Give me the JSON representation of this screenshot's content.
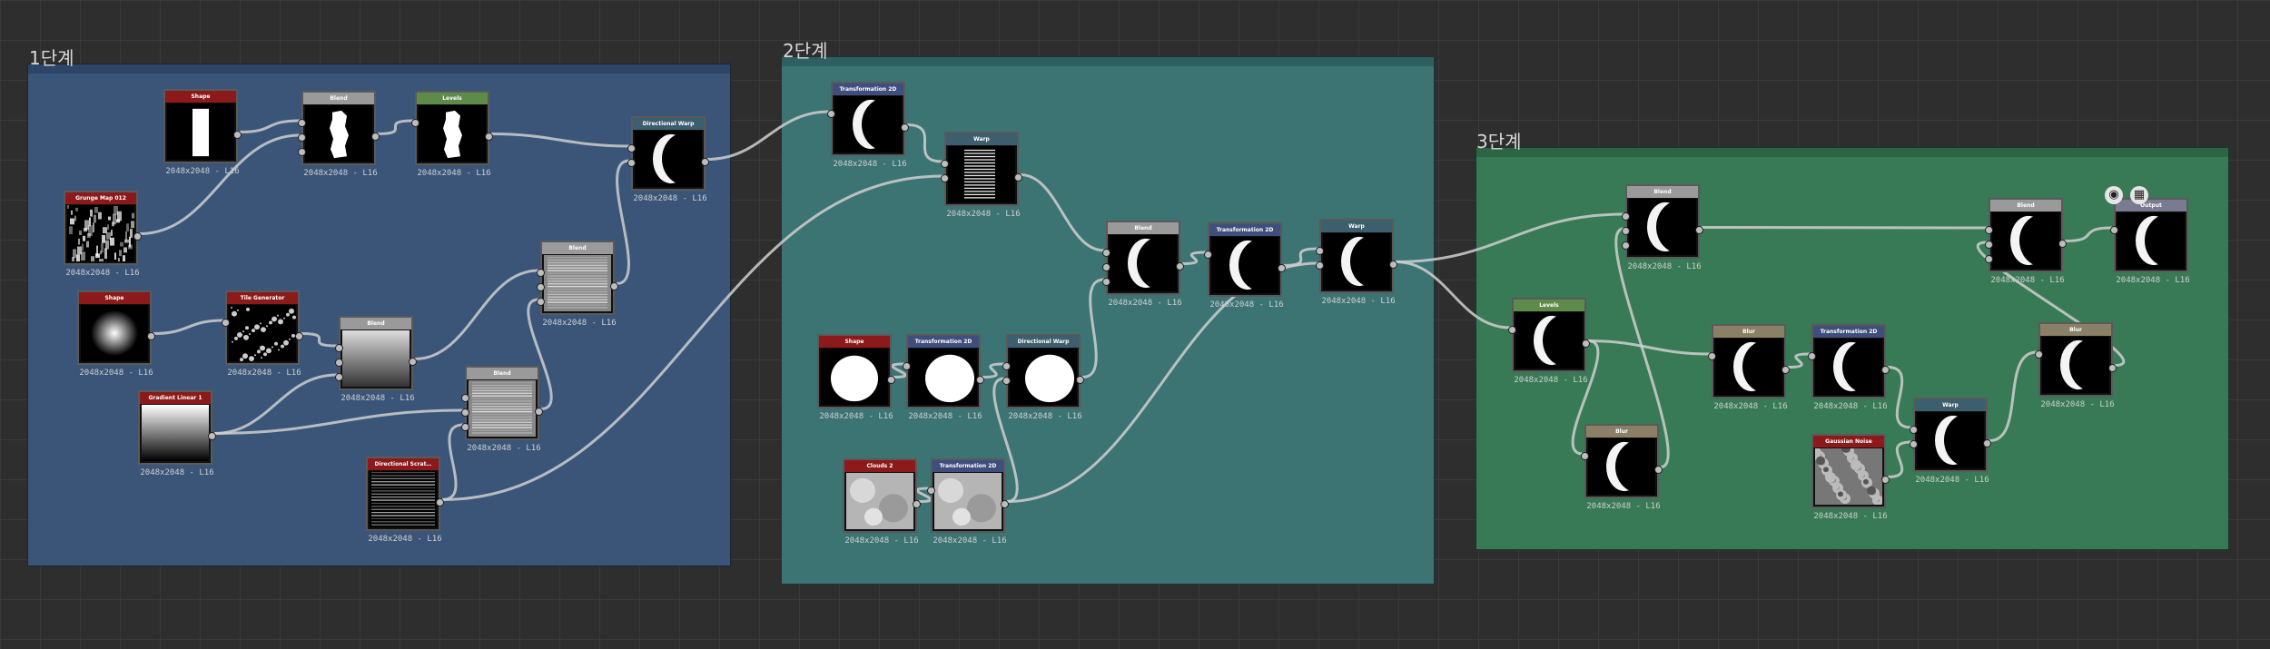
{
  "colors": {
    "canvas_bg": "#2e2e2e",
    "frame_1": "#3a5578",
    "frame_2": "#3c7373",
    "frame_3": "#387a56",
    "header_generator": "#8c1a1a",
    "header_blend": "#9a9a9a",
    "header_levels": "#5e8a4a",
    "header_filter": "#3d5e6e",
    "header_transform": "#3f4e7c",
    "header_blur": "#8a8066",
    "header_output": "#7a7a90",
    "link": "#cfcfcf"
  },
  "frames": {
    "frame_1": {
      "title": "1단계"
    },
    "frame_2": {
      "title": "2단계"
    },
    "frame_3": {
      "title": "3단계"
    }
  },
  "toolbar": {
    "icon_1": "eye-icon",
    "icon_2": "checker-icon"
  },
  "nodes": [
    {
      "id": "n-shape-1",
      "label": "Shape",
      "caption": "2048x2048 - L16",
      "header": "header_generator",
      "thumb": "rect-bar",
      "inputs": 0,
      "outputs": 1
    },
    {
      "id": "n-blend-1",
      "label": "Blend",
      "caption": "2048x2048 - L16",
      "header": "header_blend",
      "thumb": "rough-bar",
      "inputs": 3,
      "outputs": 1
    },
    {
      "id": "n-levels-1",
      "label": "Levels",
      "caption": "2048x2048 - L16",
      "header": "header_levels",
      "thumb": "rough-bar",
      "inputs": 1,
      "outputs": 1
    },
    {
      "id": "n-dirwarp-1",
      "label": "Directional Warp",
      "caption": "2048x2048 - L16",
      "header": "header_filter",
      "thumb": "crescent",
      "inputs": 2,
      "outputs": 1
    },
    {
      "id": "n-grunge",
      "label": "Grunge Map 012",
      "caption": "2048x2048 - L16",
      "header": "header_generator",
      "thumb": "grunge",
      "inputs": 0,
      "outputs": 1
    },
    {
      "id": "n-blend-2",
      "label": "Blend",
      "caption": "2048x2048 - L16",
      "header": "header_blend",
      "thumb": "streaks",
      "inputs": 3,
      "outputs": 1
    },
    {
      "id": "n-shape-2",
      "label": "Shape",
      "caption": "2048x2048 - L16",
      "header": "header_generator",
      "thumb": "radial",
      "inputs": 0,
      "outputs": 1
    },
    {
      "id": "n-tile",
      "label": "Tile Generator",
      "caption": "2048x2048 - L16",
      "header": "header_generator",
      "thumb": "dots",
      "inputs": 1,
      "outputs": 1
    },
    {
      "id": "n-blend-3",
      "label": "Blend",
      "caption": "2048x2048 - L16",
      "header": "header_blend",
      "thumb": "noisy-gradient",
      "inputs": 3,
      "outputs": 1
    },
    {
      "id": "n-gradient",
      "label": "Gradient Linear 1",
      "caption": "2048x2048 - L16",
      "header": "header_generator",
      "thumb": "linear-gradient",
      "inputs": 0,
      "outputs": 1
    },
    {
      "id": "n-blend-4",
      "label": "Blend",
      "caption": "2048x2048 - L16",
      "header": "header_blend",
      "thumb": "streaks",
      "inputs": 3,
      "outputs": 1
    },
    {
      "id": "n-dirscratch",
      "label": "Directional Scrat…",
      "caption": "2048x2048 - L16",
      "header": "header_generator",
      "thumb": "scratches",
      "inputs": 0,
      "outputs": 1
    },
    {
      "id": "n-transform-1",
      "label": "Transformation 2D",
      "caption": "2048x2048 - L16",
      "header": "header_transform",
      "thumb": "crescent",
      "inputs": 1,
      "outputs": 1
    },
    {
      "id": "n-warp-1",
      "label": "Warp",
      "caption": "2048x2048 - L16",
      "header": "header_filter",
      "thumb": "crescent-streaks",
      "inputs": 2,
      "outputs": 1
    },
    {
      "id": "n-blend-5",
      "label": "Blend",
      "caption": "2048x2048 - L16",
      "header": "header_blend",
      "thumb": "crescent",
      "inputs": 3,
      "outputs": 1
    },
    {
      "id": "n-transform-2",
      "label": "Transformation 2D",
      "caption": "2048x2048 - L16",
      "header": "header_transform",
      "thumb": "crescent",
      "inputs": 1,
      "outputs": 1
    },
    {
      "id": "n-warp-2",
      "label": "Warp",
      "caption": "2048x2048 - L16",
      "header": "header_filter",
      "thumb": "crescent",
      "inputs": 2,
      "outputs": 1
    },
    {
      "id": "n-shape-3",
      "label": "Shape",
      "caption": "2048x2048 - L16",
      "header": "header_generator",
      "thumb": "disc",
      "inputs": 0,
      "outputs": 1
    },
    {
      "id": "n-transform-3",
      "label": "Transformation 2D",
      "caption": "2048x2048 - L16",
      "header": "header_transform",
      "thumb": "disc-shift",
      "inputs": 1,
      "outputs": 1
    },
    {
      "id": "n-dirwarp-2",
      "label": "Directional Warp",
      "caption": "2048x2048 - L16",
      "header": "header_filter",
      "thumb": "disc-shift",
      "inputs": 2,
      "outputs": 1
    },
    {
      "id": "n-clouds",
      "label": "Clouds 2",
      "caption": "2048x2048 - L16",
      "header": "header_generator",
      "thumb": "clouds",
      "inputs": 0,
      "outputs": 1
    },
    {
      "id": "n-transform-4",
      "label": "Transformation 2D",
      "caption": "2048x2048 - L16",
      "header": "header_transform",
      "thumb": "clouds",
      "inputs": 1,
      "outputs": 1
    },
    {
      "id": "n-blend-6",
      "label": "Blend",
      "caption": "2048x2048 - L16",
      "header": "header_blend",
      "thumb": "crescent",
      "inputs": 3,
      "outputs": 1
    },
    {
      "id": "n-levels-2",
      "label": "Levels",
      "caption": "2048x2048 - L16",
      "header": "header_levels",
      "thumb": "crescent",
      "inputs": 1,
      "outputs": 1
    },
    {
      "id": "n-blur-1",
      "label": "Blur",
      "caption": "2048x2048 - L16",
      "header": "header_blur",
      "thumb": "crescent",
      "inputs": 1,
      "outputs": 1
    },
    {
      "id": "n-blur-2",
      "label": "Blur",
      "caption": "2048x2048 - L16",
      "header": "header_blur",
      "thumb": "crescent",
      "inputs": 1,
      "outputs": 1
    },
    {
      "id": "n-transform-5",
      "label": "Transformation 2D",
      "caption": "2048x2048 - L16",
      "header": "header_transform",
      "thumb": "crescent",
      "inputs": 1,
      "outputs": 1
    },
    {
      "id": "n-gauss",
      "label": "Gaussian Noise",
      "caption": "2048x2048 - L16",
      "header": "header_generator",
      "thumb": "noise",
      "inputs": 0,
      "outputs": 1
    },
    {
      "id": "n-warp-3",
      "label": "Warp",
      "caption": "2048x2048 - L16",
      "header": "header_filter",
      "thumb": "crescent",
      "inputs": 2,
      "outputs": 1
    },
    {
      "id": "n-blend-7",
      "label": "Blend",
      "caption": "2048x2048 - L16",
      "header": "header_blend",
      "thumb": "crescent",
      "inputs": 3,
      "outputs": 1
    },
    {
      "id": "n-blur-3",
      "label": "Blur",
      "caption": "2048x2048 - L16",
      "header": "header_blur",
      "thumb": "crescent",
      "inputs": 1,
      "outputs": 1
    },
    {
      "id": "n-output",
      "label": "Output",
      "caption": "2048x2048 - L16",
      "header": "header_output",
      "thumb": "crescent",
      "inputs": 1,
      "outputs": 0
    }
  ],
  "links": [
    [
      "n-shape-1",
      "n-blend-1",
      0
    ],
    [
      "n-grunge",
      "n-blend-1",
      1
    ],
    [
      "n-blend-1",
      "n-levels-1",
      0
    ],
    [
      "n-levels-1",
      "n-dirwarp-1",
      0
    ],
    [
      "n-blend-2",
      "n-dirwarp-1",
      1
    ],
    [
      "n-shape-2",
      "n-tile",
      0
    ],
    [
      "n-tile",
      "n-blend-3",
      0
    ],
    [
      "n-gradient",
      "n-blend-3",
      2
    ],
    [
      "n-blend-3",
      "n-blend-2",
      0
    ],
    [
      "n-gradient",
      "n-blend-4",
      1
    ],
    [
      "n-dirscratch",
      "n-blend-4",
      2
    ],
    [
      "n-blend-4",
      "n-blend-2",
      2
    ],
    [
      "n-dirscratch",
      "n-warp-1",
      1
    ],
    [
      "n-dirwarp-1",
      "n-transform-1",
      0
    ],
    [
      "n-transform-1",
      "n-warp-1",
      0
    ],
    [
      "n-warp-1",
      "n-blend-5",
      0
    ],
    [
      "n-shape-3",
      "n-transform-3",
      0
    ],
    [
      "n-transform-3",
      "n-dirwarp-2",
      0
    ],
    [
      "n-transform-4",
      "n-dirwarp-2",
      1
    ],
    [
      "n-clouds",
      "n-transform-4",
      0
    ],
    [
      "n-dirwarp-2",
      "n-blend-5",
      2
    ],
    [
      "n-blend-5",
      "n-transform-2",
      0
    ],
    [
      "n-transform-2",
      "n-warp-2",
      0
    ],
    [
      "n-transform-4",
      "n-warp-2",
      1
    ],
    [
      "n-warp-2",
      "n-blend-6",
      0
    ],
    [
      "n-warp-2",
      "n-levels-2",
      0
    ],
    [
      "n-levels-2",
      "n-blur-1",
      0
    ],
    [
      "n-blur-1",
      "n-blend-6",
      1
    ],
    [
      "n-levels-2",
      "n-blur-2",
      0
    ],
    [
      "n-blur-2",
      "n-transform-5",
      0
    ],
    [
      "n-transform-5",
      "n-warp-3",
      0
    ],
    [
      "n-gauss",
      "n-warp-3",
      1
    ],
    [
      "n-warp-3",
      "n-blur-3",
      0
    ],
    [
      "n-blend-6",
      "n-blend-7",
      0
    ],
    [
      "n-blur-3",
      "n-blend-7",
      1
    ],
    [
      "n-blend-7",
      "n-output",
      0
    ]
  ]
}
